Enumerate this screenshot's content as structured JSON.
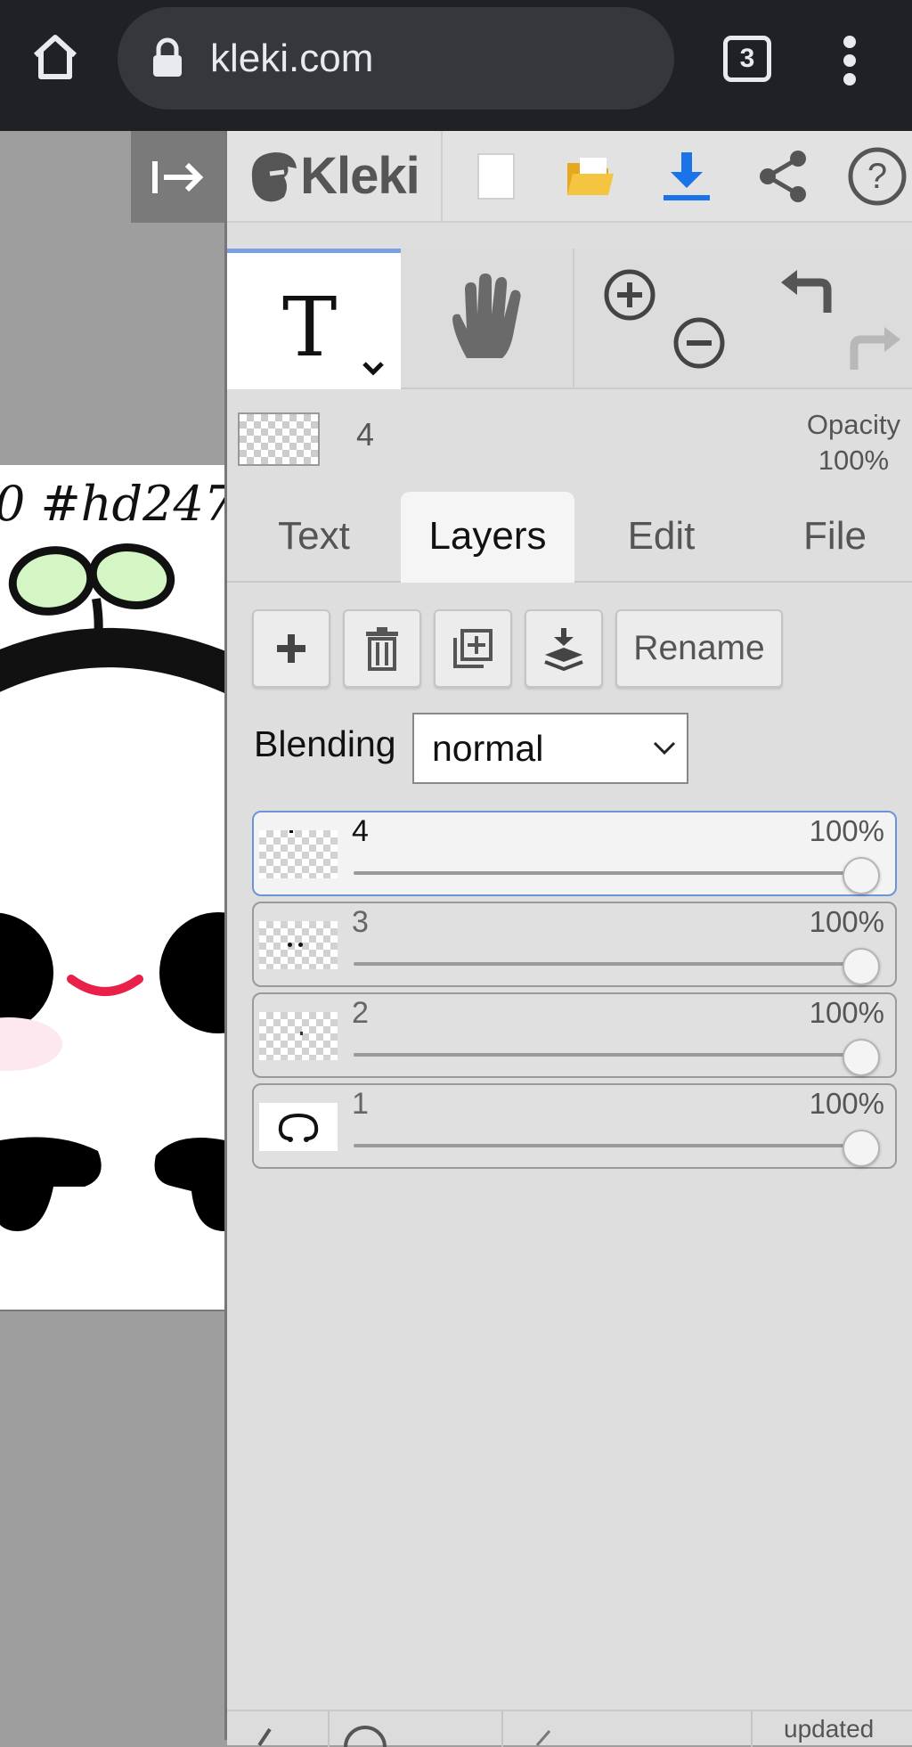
{
  "browser": {
    "url": "kleki.com",
    "tab_count": "3",
    "icons": [
      "home-icon",
      "lock-icon",
      "tabs-icon",
      "more-vert-icon"
    ]
  },
  "canvas": {
    "hashtag_text": "0 #hd247"
  },
  "toolbar": {
    "logo": "Kleki",
    "icons": [
      "new-image-icon",
      "open-folder-icon",
      "download-icon",
      "share-icon",
      "help-icon"
    ],
    "colors": {
      "folder": "#f0b429",
      "download": "#1a73e8"
    }
  },
  "tools": {
    "active_tool_glyph": "T",
    "icons": [
      "text-tool-icon",
      "hand-tool-icon",
      "zoom-in-icon",
      "zoom-out-icon",
      "undo-icon",
      "redo-icon"
    ]
  },
  "layer_info": {
    "current_layer": "4",
    "opacity_label": "Opacity",
    "opacity_value": "100%"
  },
  "tabs": [
    {
      "label": "Text"
    },
    {
      "label": "Layers"
    },
    {
      "label": "Edit"
    },
    {
      "label": "File"
    }
  ],
  "layers_panel": {
    "rename_label": "Rename",
    "blending_label": "Blending",
    "blending_value": "normal",
    "layers": [
      {
        "name": "4",
        "opacity": "100%",
        "opacity_fraction": 1.0,
        "active": true
      },
      {
        "name": "3",
        "opacity": "100%",
        "opacity_fraction": 1.0,
        "active": false
      },
      {
        "name": "2",
        "opacity": "100%",
        "opacity_fraction": 1.0,
        "active": false
      },
      {
        "name": "1",
        "opacity": "100%",
        "opacity_fraction": 1.0,
        "active": false
      }
    ]
  },
  "status": {
    "updated_text": "updated"
  },
  "colors": {
    "accent_blue": "#6d94d9",
    "smile_red": "#e8204a",
    "leaf_green": "#d4f5c4"
  }
}
